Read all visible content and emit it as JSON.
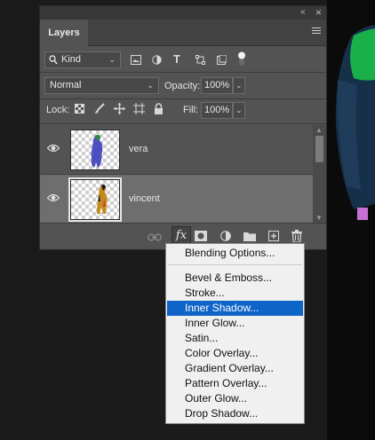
{
  "panel": {
    "tab_label": "Layers",
    "collapse_glyph": "«",
    "close_glyph": "×"
  },
  "filter": {
    "kind_label": "Kind",
    "icons": [
      "image-filter-icon",
      "adjustment-filter-icon",
      "type-filter-icon",
      "shape-filter-icon",
      "smart-object-filter-icon",
      "filter-toggle-icon"
    ]
  },
  "blend": {
    "mode": "Normal",
    "opacity_label": "Opacity:",
    "opacity_value": "100%"
  },
  "lock": {
    "label": "Lock:",
    "fill_label": "Fill:",
    "fill_value": "100%"
  },
  "layers": [
    {
      "name": "vera",
      "visible": true,
      "selected": false
    },
    {
      "name": "vincent",
      "visible": true,
      "selected": true
    }
  ],
  "bottom_icons": [
    "link-layers-icon",
    "fx-icon",
    "layer-mask-icon",
    "adjustment-layer-icon",
    "group-folder-icon",
    "new-layer-icon",
    "trash-icon"
  ],
  "fx_label": "fx",
  "context_menu": {
    "items": [
      "Blending Options...",
      "Bevel & Emboss...",
      "Stroke...",
      "Inner Shadow...",
      "Inner Glow...",
      "Satin...",
      "Color Overlay...",
      "Gradient Overlay...",
      "Pattern Overlay...",
      "Outer Glow...",
      "Drop Shadow..."
    ],
    "highlighted": "Inner Shadow..."
  },
  "colors": {
    "highlight": "#0f64c8",
    "panel": "#535353",
    "selected_layer": "#6e6e6e"
  }
}
